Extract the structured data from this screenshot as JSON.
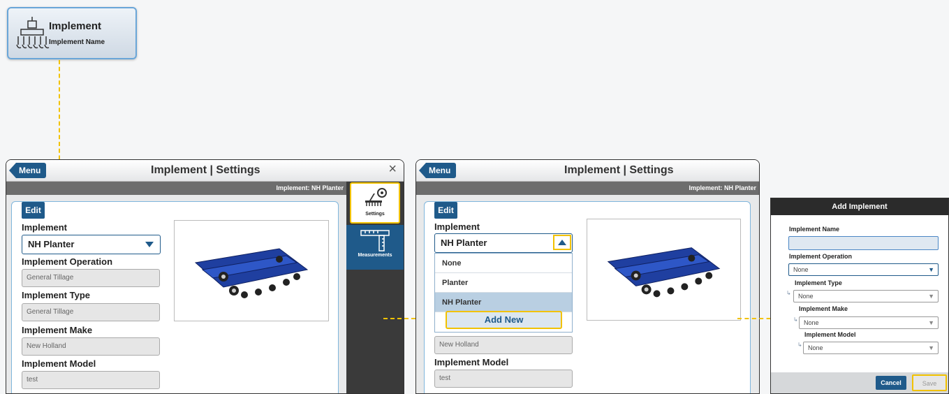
{
  "tile": {
    "title": "Implement",
    "subtitle": "Implement Name",
    "icon": "implement-icon"
  },
  "win1": {
    "menu": "Menu",
    "title": "Implement | Settings",
    "close": "×",
    "subbar": "Implement: NH Planter",
    "edit": "Edit",
    "labels": {
      "implement": "Implement",
      "operation": "Implement Operation",
      "type": "Implement Type",
      "make": "Implement Make",
      "model": "Implement Model"
    },
    "values": {
      "implement": "NH Planter",
      "operation": "General Tillage",
      "type": "General Tillage",
      "make": "New Holland",
      "model": "test"
    },
    "sidebar": {
      "settings": "Settings",
      "measurements": "Measurements"
    }
  },
  "win2": {
    "menu": "Menu",
    "title": "Implement | Settings",
    "subbar": "Implement: NH Planter",
    "edit": "Edit",
    "labels": {
      "implement": "Implement",
      "model": "Implement Model"
    },
    "values": {
      "implement": "NH Planter",
      "make": "New Holland",
      "model": "test"
    },
    "options": [
      "None",
      "Planter",
      "NH Planter"
    ],
    "selected_option": "NH Planter",
    "add_new": "Add New"
  },
  "dialog": {
    "title": "Add Implement",
    "labels": {
      "name": "Implement Name",
      "operation": "Implement Operation",
      "type": "Implement Type",
      "make": "Implement Make",
      "model": "Implement Model"
    },
    "values": {
      "name": "",
      "operation": "None",
      "type": "None",
      "make": "None",
      "model": "None"
    },
    "cancel": "Cancel",
    "save": "Save"
  },
  "colors": {
    "accent": "#1f5a8a",
    "highlight": "#f2c200",
    "panel_border": "#7fb6dc"
  }
}
